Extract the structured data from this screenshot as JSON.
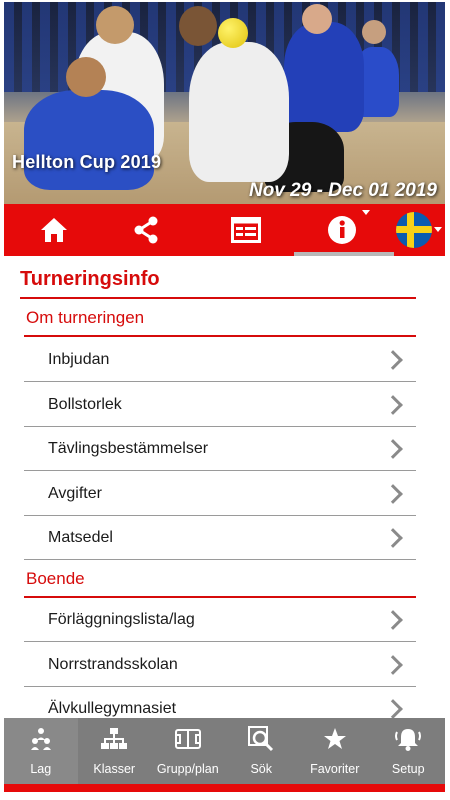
{
  "hero": {
    "title": "Hellton Cup 2019",
    "dates": "Nov 29 - Dec 01 2019"
  },
  "toolbar": {
    "items": [
      {
        "name": "home",
        "icon": "home-icon"
      },
      {
        "name": "share",
        "icon": "share-icon"
      },
      {
        "name": "schedule",
        "icon": "calendar-icon"
      },
      {
        "name": "info",
        "icon": "info-icon",
        "active": true
      },
      {
        "name": "language",
        "icon": "swedish-flag-icon"
      }
    ],
    "accent": "#e60a0a"
  },
  "content": {
    "title": "Turneringsinfo",
    "sections": [
      {
        "heading": "Om turneringen",
        "items": [
          "Inbjudan",
          "Bollstorlek",
          "Tävlingsbestämmelser",
          "Avgifter",
          "Matsedel"
        ]
      },
      {
        "heading": "Boende",
        "items": [
          "Förläggningslista/lag",
          "Norrstrandsskolan",
          "Älvkullegymnasiet"
        ]
      }
    ]
  },
  "bottom_nav": {
    "items": [
      {
        "label": "Lag",
        "icon": "team-icon"
      },
      {
        "label": "Klasser",
        "icon": "hierarchy-icon"
      },
      {
        "label": "Grupp/plan",
        "icon": "field-icon"
      },
      {
        "label": "Sök",
        "icon": "search-icon"
      },
      {
        "label": "Favoriter",
        "icon": "star-icon"
      },
      {
        "label": "Setup",
        "icon": "bell-icon"
      }
    ]
  },
  "colors": {
    "primary_red": "#e60a0a",
    "heading_red": "#d60b0b",
    "nav_gray": "#7d7d7d"
  }
}
